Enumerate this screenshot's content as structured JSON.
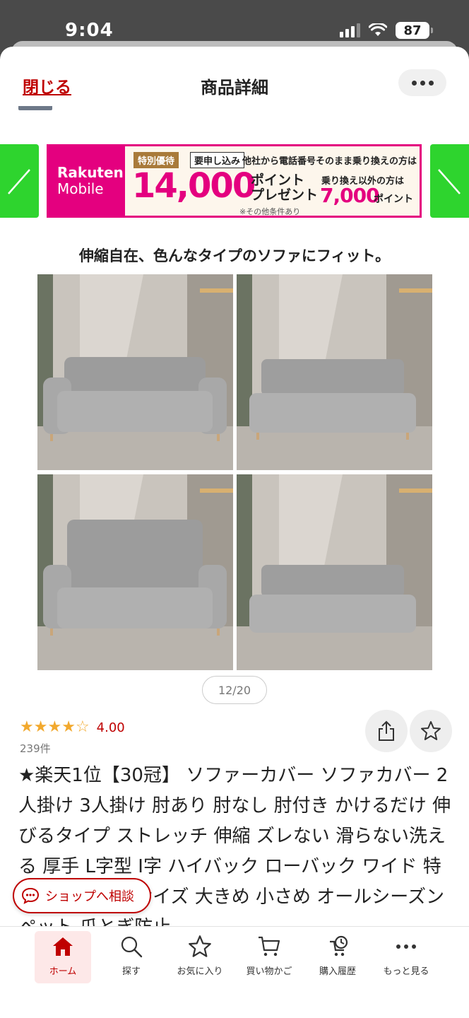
{
  "status_bar": {
    "time": "9:04",
    "battery": "87"
  },
  "header": {
    "close_label": "閉じる",
    "title": "商品詳細"
  },
  "banner": {
    "brand_line1": "Rakuten",
    "brand_line2": "Mobile",
    "tag_special": "特別優待",
    "tag_apply": "要申し込み",
    "headline": "他社から電話番号そのまま乗り換えの方は",
    "points_big": "14,000",
    "points_label_1": "ポイント",
    "points_label_2": "プレゼント",
    "alt_text": "乗り換え以外の方は",
    "alt_points": "7,000",
    "alt_points_label": "ポイント",
    "note": "※その他条件あり"
  },
  "section_caption": "伸縮自在、色んなタイプのソファにフィット。",
  "gallery": {
    "counter": "12/20"
  },
  "rating": {
    "value": "4.00",
    "stars_filled": 4,
    "stars_total": 5,
    "review_count": "239件"
  },
  "product_title": "★楽天1位【30冠】 ソファーカバー ソファカバー 2人掛け 3人掛け 肘あり 肘なし 肘付き かけるだけ 伸びるタイプ ストレッチ 伸縮 ズレない 滑らない洗える 厚手 L字型 I字 ハイバック ローバック ワイド 特殊形状 大きいサイズ 大きめ 小さめ オールシーズン ペット 爪とぎ防止",
  "consult_button": "ショップへ相談",
  "tabs": [
    {
      "label": "ホーム",
      "icon": "home-icon"
    },
    {
      "label": "探す",
      "icon": "search-icon"
    },
    {
      "label": "お気に入り",
      "icon": "star-icon"
    },
    {
      "label": "買い物かご",
      "icon": "cart-icon"
    },
    {
      "label": "購入履歴",
      "icon": "history-icon"
    },
    {
      "label": "もっと見る",
      "icon": "more-icon"
    }
  ],
  "colors": {
    "accent": "#bf0000",
    "rakuten_pink": "#e4007f",
    "arrow_green": "#2ed42e",
    "star": "#f2a92e"
  }
}
